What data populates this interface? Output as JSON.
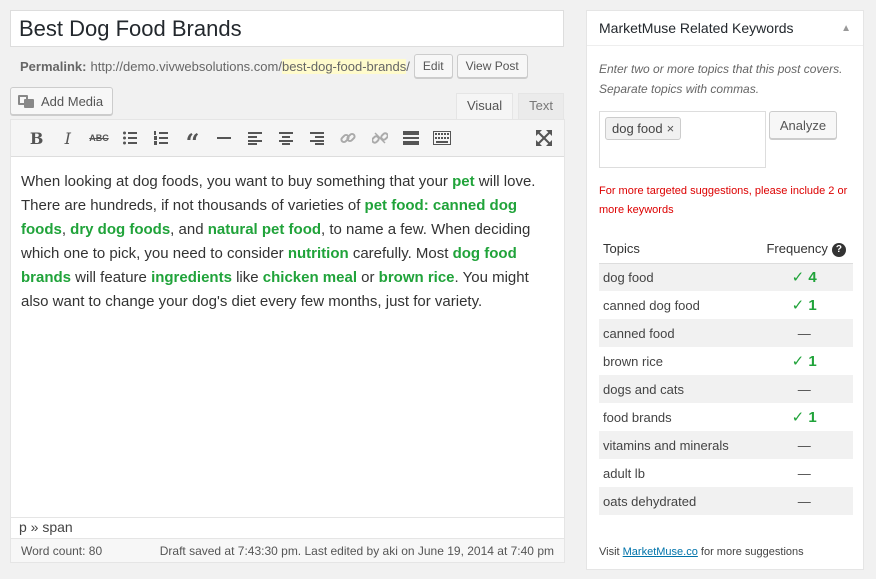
{
  "post": {
    "title": "Best Dog Food Brands",
    "permalink_label": "Permalink:",
    "permalink_base": "http://demo.vivwebsolutions.com/",
    "permalink_slug": "best-dog-food-brands",
    "permalink_trail": "/",
    "edit_label": "Edit",
    "view_label": "View Post"
  },
  "editor": {
    "add_media_label": "Add Media",
    "tabs": [
      "Visual",
      "Text"
    ],
    "active_tab": "Visual",
    "toolbar": [
      {
        "name": "bold-button",
        "icon": "bold-icon"
      },
      {
        "name": "italic-button",
        "icon": "italic-icon"
      },
      {
        "name": "strikethrough-button",
        "icon": "strikethrough-icon"
      },
      {
        "name": "bullet-list-button",
        "icon": "bullet-list-icon"
      },
      {
        "name": "numbered-list-button",
        "icon": "numbered-list-icon"
      },
      {
        "name": "blockquote-button",
        "icon": "quote-icon"
      },
      {
        "name": "horizontal-rule-button",
        "icon": "hr-icon"
      },
      {
        "name": "align-left-button",
        "icon": "align-left-icon"
      },
      {
        "name": "align-center-button",
        "icon": "align-center-icon"
      },
      {
        "name": "align-right-button",
        "icon": "align-right-icon"
      },
      {
        "name": "insert-link-button",
        "icon": "link-icon"
      },
      {
        "name": "remove-link-button",
        "icon": "unlink-icon"
      },
      {
        "name": "read-more-button",
        "icon": "read-more-icon"
      },
      {
        "name": "toolbar-toggle-button",
        "icon": "keyboard-icon"
      },
      {
        "name": "fullscreen-button",
        "icon": "fullscreen-icon"
      }
    ],
    "content": [
      {
        "t": "When looking at dog foods, you want to buy something that your "
      },
      {
        "t": "pet",
        "kw": true
      },
      {
        "t": " will love. There are hundreds, if not thousands of varieties of "
      },
      {
        "t": "pet food",
        "kw": true
      },
      {
        "t": ": ",
        "kw": true
      },
      {
        "t": "canned dog foods",
        "kw": true
      },
      {
        "t": ", "
      },
      {
        "t": "dry dog foods",
        "kw": true
      },
      {
        "t": ", and "
      },
      {
        "t": "natural pet food",
        "kw": true
      },
      {
        "t": ", to name a few. When deciding which one to pick, you need to consider "
      },
      {
        "t": "nutrition",
        "kw": true
      },
      {
        "t": " carefully. Most "
      },
      {
        "t": "dog food brands",
        "kw": true
      },
      {
        "t": " will feature "
      },
      {
        "t": "ingredients",
        "kw": true
      },
      {
        "t": " like "
      },
      {
        "t": "chicken meal",
        "kw": true
      },
      {
        "t": " or "
      },
      {
        "t": "brown rice",
        "kw": true
      },
      {
        "t": ". You might also want to change your dog's diet every few months, just for variety."
      }
    ],
    "path": "p » span",
    "word_count": "Word count: 80",
    "status": "Draft saved at 7:43:30 pm. Last edited by aki on June 19, 2014 at 7:40 pm"
  },
  "marketmuse": {
    "title": "MarketMuse Related Keywords",
    "instructions": "Enter two or more topics that this post covers. Separate topics with commas.",
    "tags": [
      "dog food"
    ],
    "analyze_label": "Analyze",
    "warning": "For more targeted suggestions, please include 2 or more keywords",
    "col_topics": "Topics",
    "col_frequency": "Frequency",
    "topics": [
      {
        "topic": "dog food",
        "count": "4"
      },
      {
        "topic": "canned dog food",
        "count": "1"
      },
      {
        "topic": "canned food",
        "count": ""
      },
      {
        "topic": "brown rice",
        "count": "1"
      },
      {
        "topic": "dogs and cats",
        "count": ""
      },
      {
        "topic": "food brands",
        "count": "1"
      },
      {
        "topic": "vitamins and minerals",
        "count": ""
      },
      {
        "topic": "adult lb",
        "count": ""
      },
      {
        "topic": "oats dehydrated",
        "count": ""
      }
    ],
    "footer_pre": "Visit ",
    "footer_link": "MarketMuse.co",
    "footer_post": " for more suggestions"
  },
  "colors": {
    "keyword": "#20a33a",
    "warning": "#dd0000",
    "link": "#0073aa"
  }
}
